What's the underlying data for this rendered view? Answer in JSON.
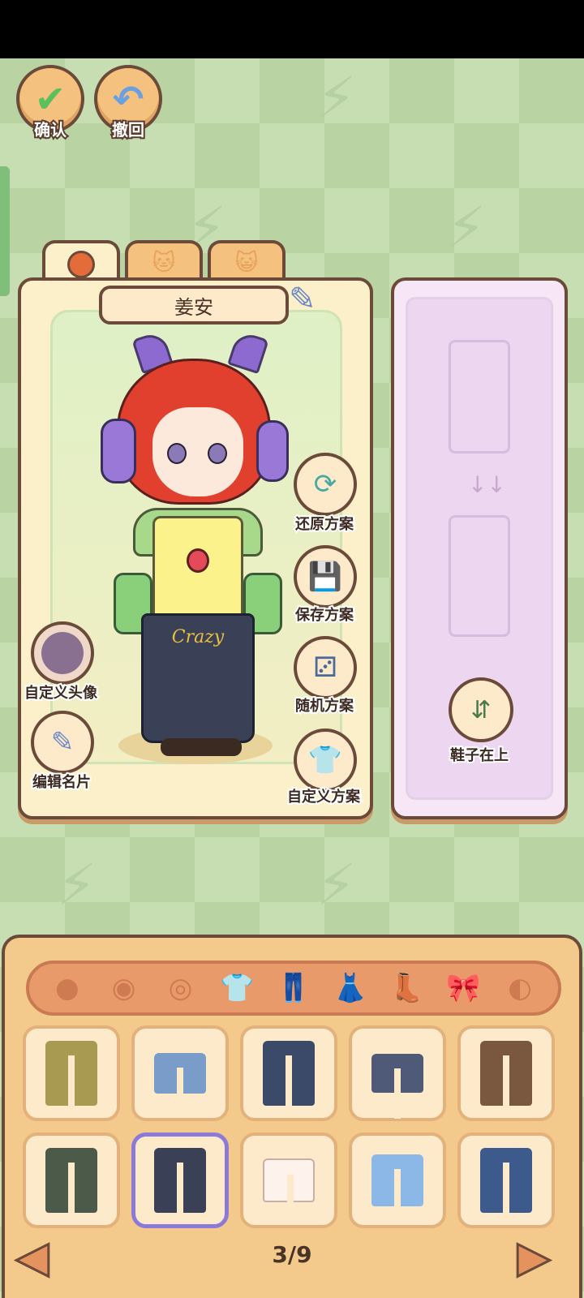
{
  "top_buttons": {
    "confirm_label": "确认",
    "undo_label": "撤回"
  },
  "profile_tabs": [
    "face",
    "cat",
    "cat-smile"
  ],
  "character": {
    "name": "姜安",
    "shirt_text": "",
    "pants_text": "Crazy"
  },
  "left_actions": {
    "custom_avatar_label": "自定义头像",
    "edit_card_label": "编辑名片"
  },
  "right_actions": {
    "restore_label": "还原方案",
    "save_label": "保存方案",
    "random_label": "随机方案",
    "custom_label": "自定义方案"
  },
  "layer_panel": {
    "shoes_on_top_label": "鞋子在上"
  },
  "categories": [
    "face-icon",
    "hair-icon",
    "eye-icon",
    "top-icon",
    "pants-icon",
    "dress-icon",
    "shoes-icon",
    "bow-icon",
    "accessory-icon"
  ],
  "active_category": "pants-icon",
  "items": [
    {
      "name": "olive-cargo-pants",
      "color": "#a89a50"
    },
    {
      "name": "denim-shorts",
      "color": "#7a9cc8"
    },
    {
      "name": "dark-jeans-frayed",
      "color": "#3c4a6a"
    },
    {
      "name": "ripped-mini-skirt",
      "color": "#4e5a78"
    },
    {
      "name": "brown-wide-pants",
      "color": "#7a5840"
    },
    {
      "name": "camo-pants",
      "color": "#4c5a4a"
    },
    {
      "name": "crazy-wide-jeans",
      "color": "#3a4055"
    },
    {
      "name": "white-bloomers",
      "color": "#fdf2ec"
    },
    {
      "name": "star-denim-shorts",
      "color": "#8cb8e8"
    },
    {
      "name": "bow-flare-jeans",
      "color": "#3c5a8c"
    }
  ],
  "selected_item": "crazy-wide-jeans",
  "pager": {
    "text": "3/9"
  }
}
